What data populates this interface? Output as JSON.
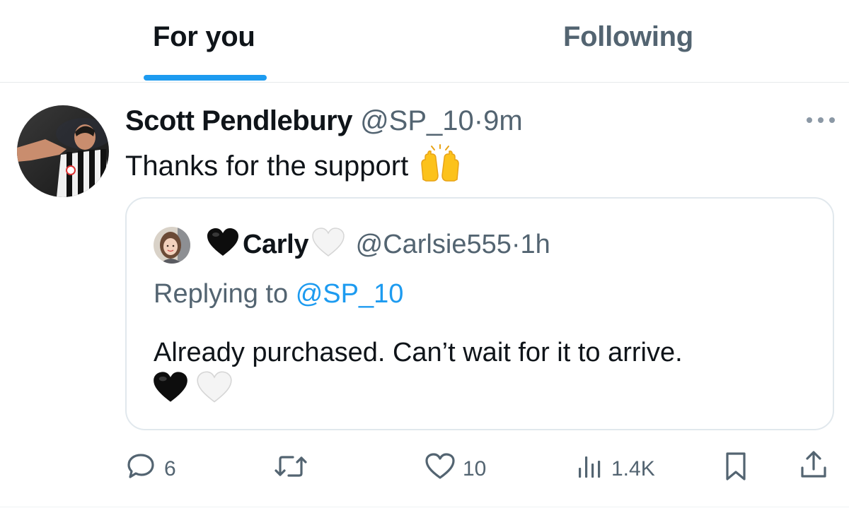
{
  "tabs": [
    {
      "label": "For you",
      "active": true
    },
    {
      "label": "Following",
      "active": false
    }
  ],
  "tweet": {
    "author_name": "Scott Pendlebury",
    "author_handle": "@SP_10",
    "separator": "·",
    "time": "9m",
    "text": "Thanks for the support",
    "emoji": "raising-hands-icon",
    "quote": {
      "author_name": "Carly",
      "author_handle": "@Carlsie555",
      "separator": "·",
      "time": "1h",
      "replying_prefix": "Replying to",
      "replying_handle": "@SP_10",
      "text": "Already purchased. Can’t wait for it to arrive.",
      "name_icons": [
        "black-heart-icon",
        "white-heart-icon"
      ],
      "trailing_icons": [
        "black-heart-icon",
        "white-heart-icon"
      ]
    },
    "actions": {
      "replies": "6",
      "likes": "10",
      "views": "1.4K"
    }
  },
  "colors": {
    "accent": "#1d9bf0",
    "secondary_text": "#536471",
    "primary_text": "#0f1419",
    "border": "#e1e8ed"
  }
}
